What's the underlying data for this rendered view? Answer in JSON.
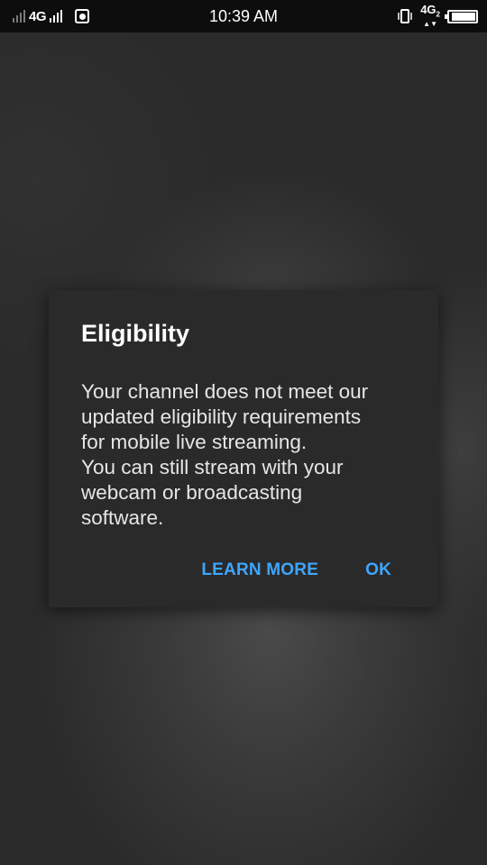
{
  "status_bar": {
    "network_left": "4G",
    "time": "10:39 AM",
    "network_right": "4G",
    "network_right_sub": "2",
    "icons": [
      "signal-icon",
      "notification-icon",
      "vibrate-icon",
      "battery-icon"
    ]
  },
  "dialog": {
    "title": "Eligibility",
    "body_lines": [
      "Your channel does not meet our",
      "updated eligibility requirements",
      "for mobile live streaming.",
      "You can still stream with your",
      "webcam or broadcasting",
      "software."
    ],
    "learn_more_label": "LEARN MORE",
    "ok_label": "OK"
  },
  "colors": {
    "accent": "#3ea6ff",
    "dialog_bg": "#2a2a2a",
    "status_bar_bg": "#0d0d0d"
  }
}
